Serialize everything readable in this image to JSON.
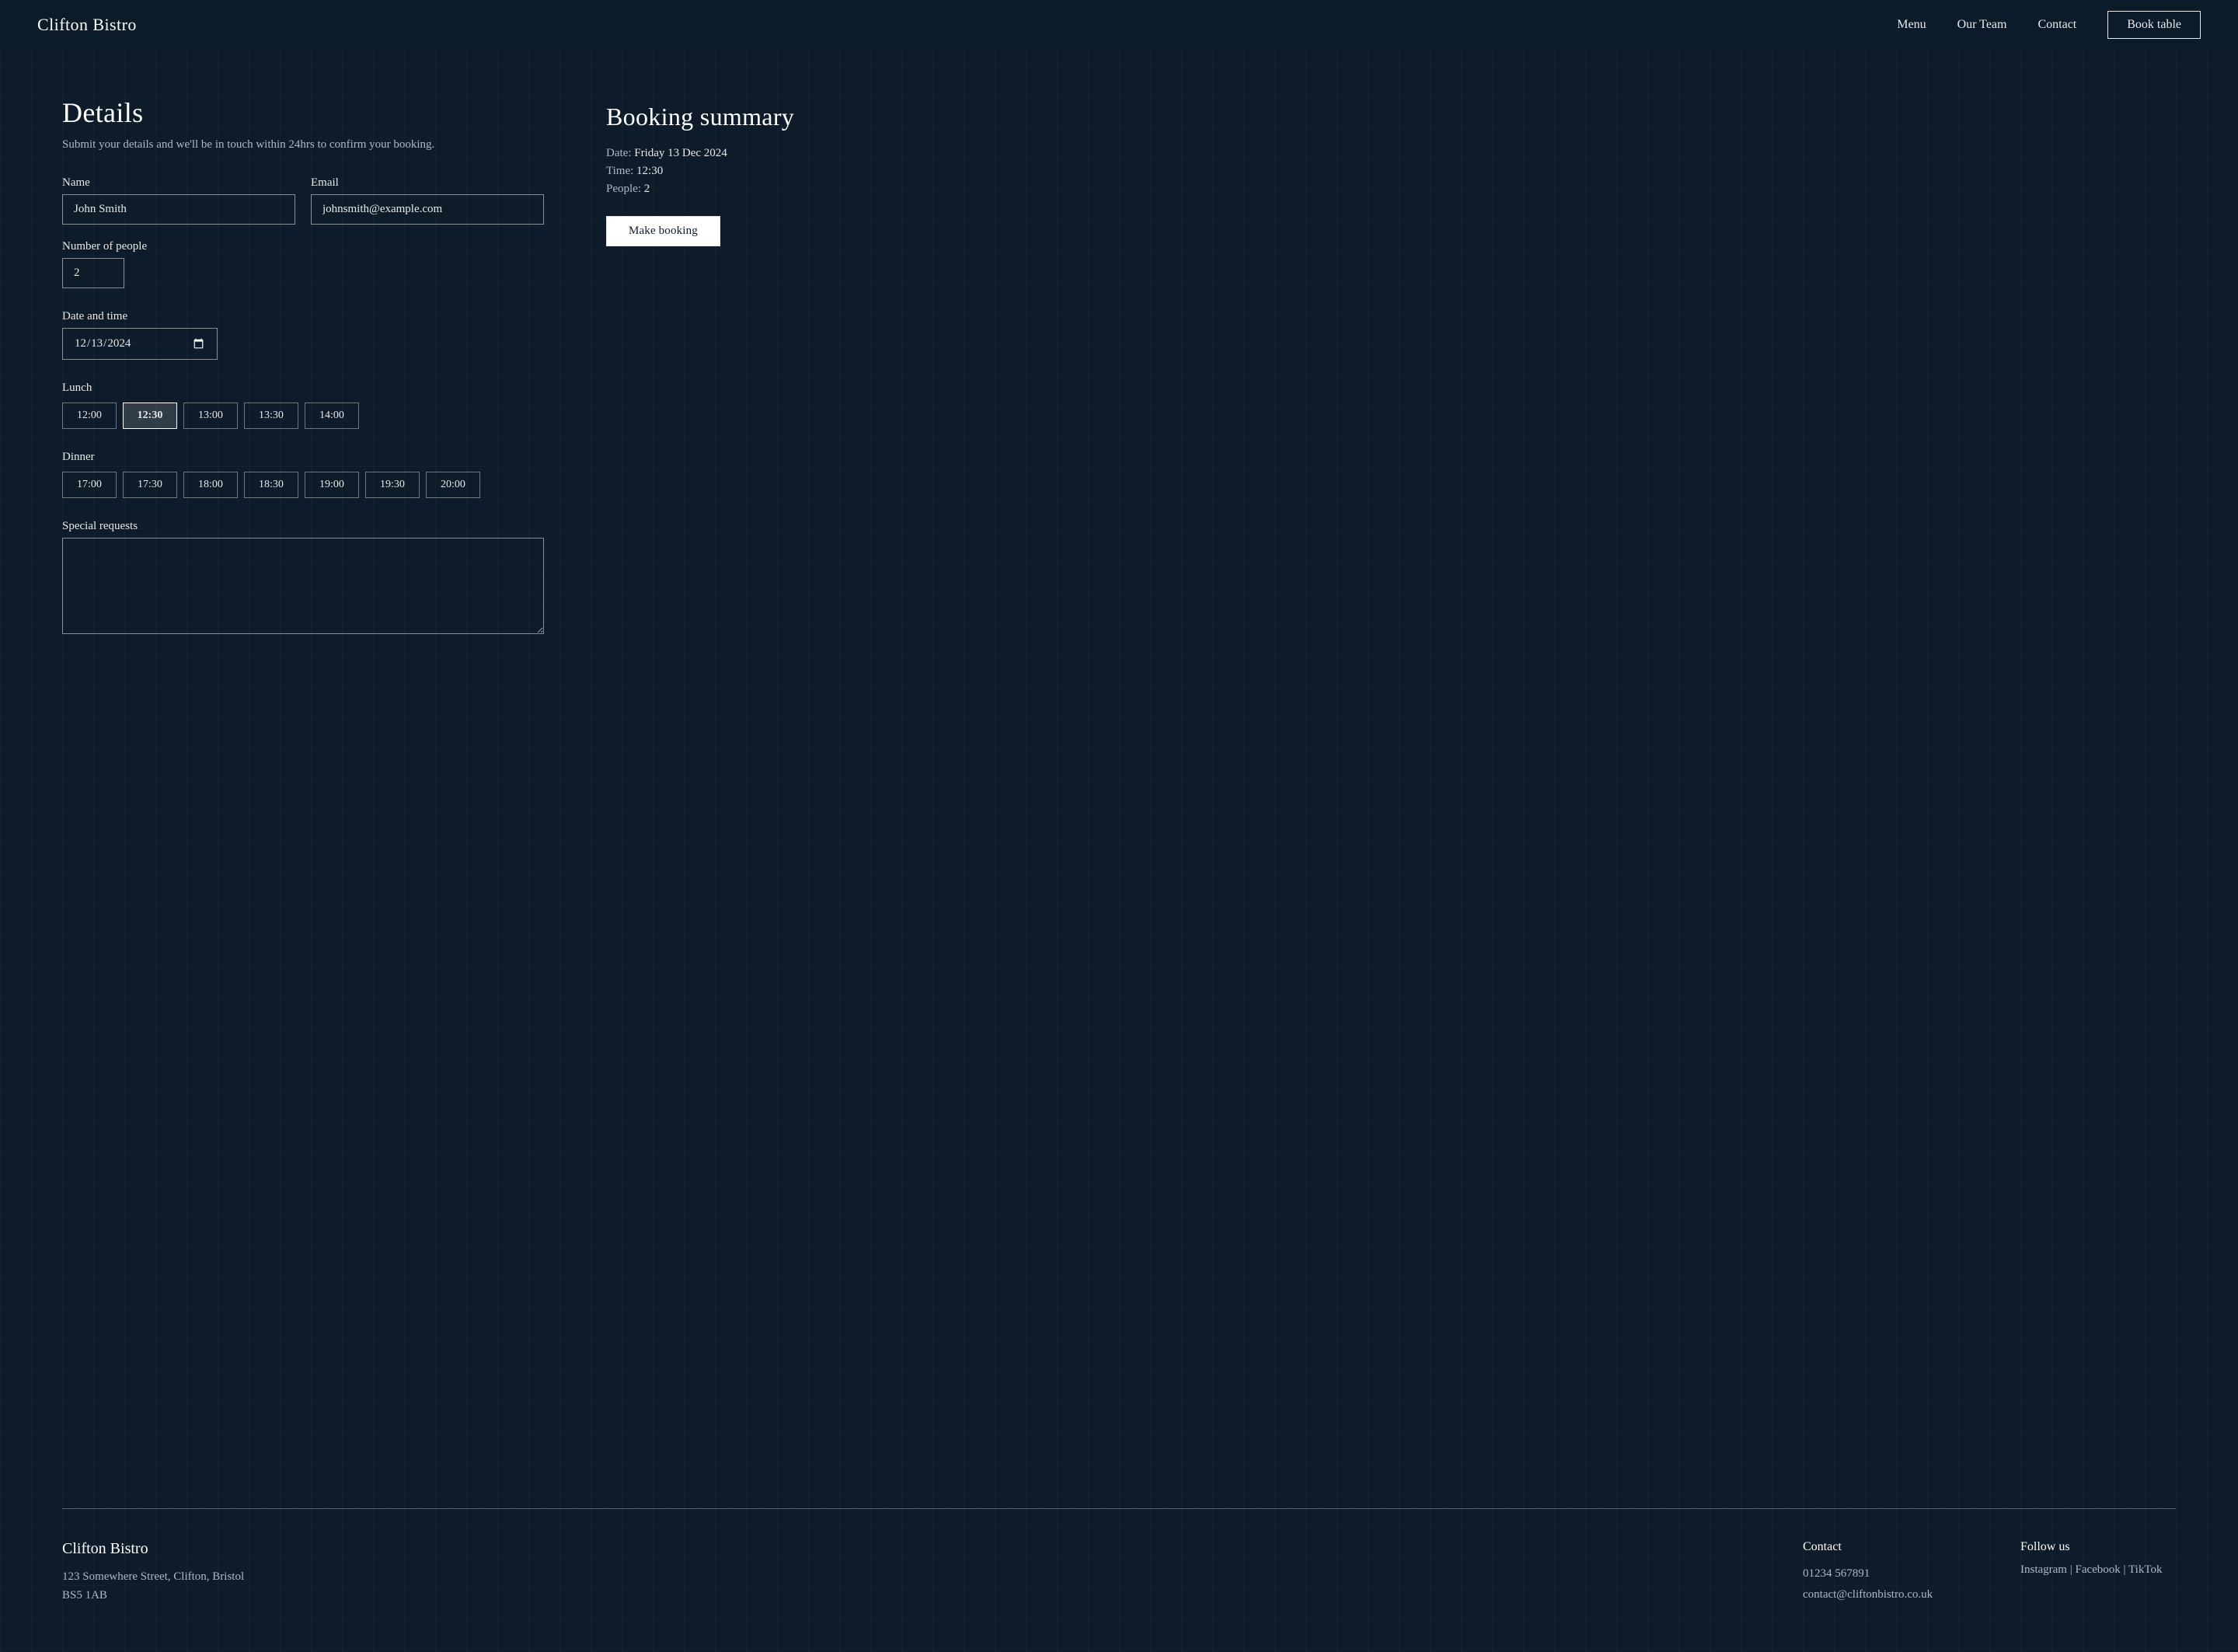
{
  "nav": {
    "logo": "Clifton Bistro",
    "links": [
      {
        "label": "Menu",
        "href": "#"
      },
      {
        "label": "Our Team",
        "href": "#"
      },
      {
        "label": "Contact",
        "href": "#"
      }
    ],
    "book_button": "Book table"
  },
  "details": {
    "title": "Details",
    "subtitle": "Submit your details and we'll be in touch within 24hrs to confirm your booking.",
    "name_label": "Name",
    "name_value": "John Smith",
    "email_label": "Email",
    "email_value": "johnsmith@example.com",
    "people_label": "Number of people",
    "people_value": "2",
    "datetime_label": "Date and time",
    "date_value": "2024-12-13",
    "lunch_label": "Lunch",
    "lunch_slots": [
      "12:00",
      "12:30",
      "13:00",
      "13:30",
      "14:00"
    ],
    "selected_lunch": "12:30",
    "dinner_label": "Dinner",
    "dinner_slots": [
      "17:00",
      "17:30",
      "18:00",
      "18:30",
      "19:00",
      "19:30",
      "20:00"
    ],
    "special_label": "Special requests",
    "special_placeholder": ""
  },
  "booking_summary": {
    "title": "Booking summary",
    "date_label": "Date:",
    "date_value": "Friday 13 Dec 2024",
    "time_label": "Time:",
    "time_value": "12:30",
    "people_label": "People:",
    "people_value": "2",
    "button_label": "Make booking"
  },
  "footer": {
    "logo": "Clifton Bistro",
    "address_line1": "123 Somewhere Street, Clifton, Bristol",
    "address_line2": "BS5 1AB",
    "contact_title": "Contact",
    "phone": "01234 567891",
    "email": "contact@cliftonbistro.co.uk",
    "follow_title": "Follow us",
    "social_links": "Instagram | Facebook | TikTok"
  }
}
